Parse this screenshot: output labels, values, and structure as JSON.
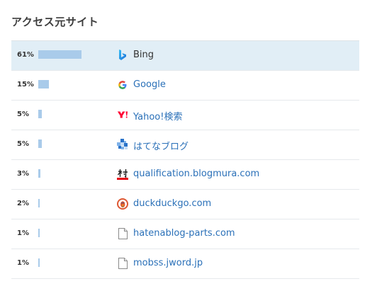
{
  "panel": {
    "title": "アクセス元サイト"
  },
  "colors": {
    "bar": "#a9cbea",
    "selected_row": "#e1eef6",
    "link": "#2a70b8"
  },
  "rows": [
    {
      "percent_label": "61%",
      "share": 0.61,
      "icon": "bing-icon",
      "label": "Bing"
    },
    {
      "percent_label": "15%",
      "share": 0.15,
      "icon": "google-icon",
      "label": "Google"
    },
    {
      "percent_label": "5%",
      "share": 0.05,
      "icon": "yahoo-icon",
      "label": "Yahoo!検索"
    },
    {
      "percent_label": "5%",
      "share": 0.05,
      "icon": "hatena-blog-icon",
      "label": "はてなブログ"
    },
    {
      "percent_label": "3%",
      "share": 0.03,
      "icon": "blogmura-icon",
      "label": "qualification.blogmura.com"
    },
    {
      "percent_label": "2%",
      "share": 0.02,
      "icon": "duckduckgo-icon",
      "label": "duckduckgo.com"
    },
    {
      "percent_label": "1%",
      "share": 0.01,
      "icon": "page-icon",
      "label": "hatenablog-parts.com"
    },
    {
      "percent_label": "1%",
      "share": 0.01,
      "icon": "page-icon",
      "label": "mobss.jword.jp"
    }
  ]
}
